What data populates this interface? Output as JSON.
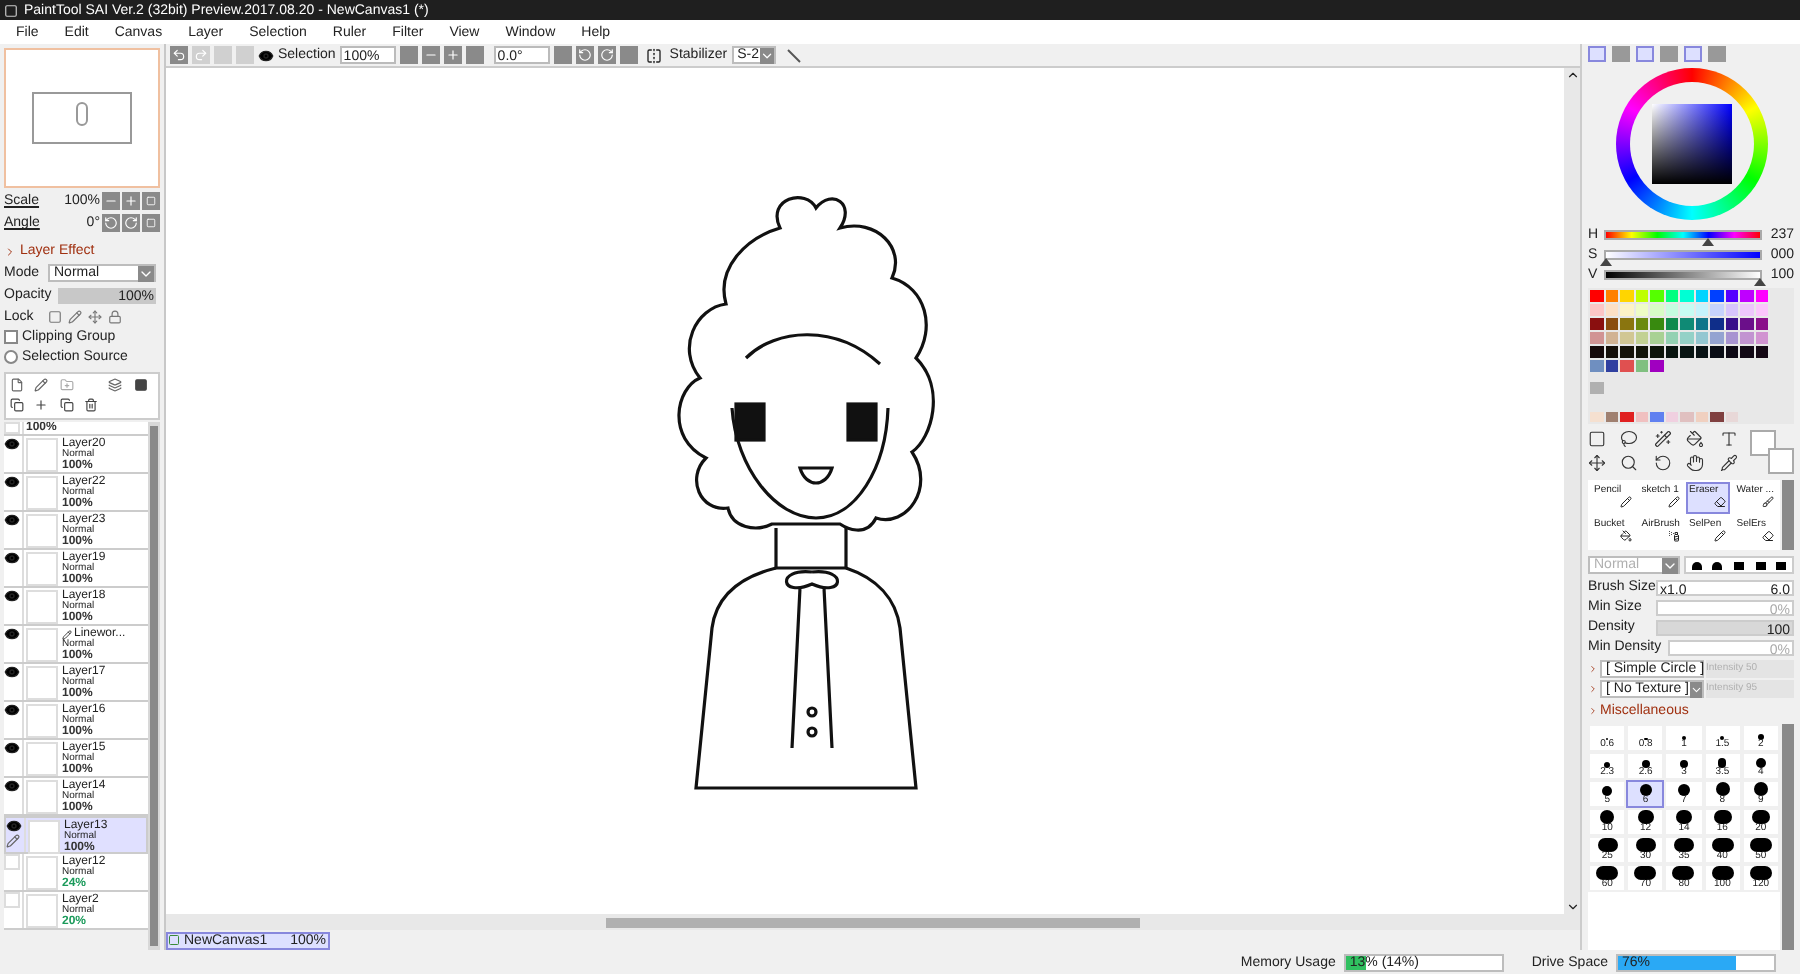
{
  "window": {
    "title": "PaintTool SAI Ver.2 (32bit) Preview.2017.08.20 - NewCanvas1 (*)"
  },
  "menu": [
    "File",
    "Edit",
    "Canvas",
    "Layer",
    "Selection",
    "Ruler",
    "Filter",
    "View",
    "Window",
    "Help"
  ],
  "toolbar": {
    "selection_label": "Selection",
    "selection_visible": true,
    "zoom": "100%",
    "angle": "0.0°",
    "stabilizer_label": "Stabilizer",
    "stabilizer": "S-2"
  },
  "navigator": {
    "scale_label": "Scale",
    "scale": "100%",
    "angle_label": "Angle",
    "angle": "0°"
  },
  "layer_effect": {
    "title": "Layer Effect",
    "mode_label": "Mode",
    "mode": "Normal",
    "opacity_label": "Opacity",
    "opacity": "100%",
    "level": 1,
    "lock_label": "Lock",
    "clipping_group": {
      "label": "Clipping Group",
      "checked": false
    },
    "selection_source": {
      "label": "Selection Source",
      "selected": false
    }
  },
  "layers": [
    {
      "kind": "partial",
      "opacity": "100%",
      "visible": false,
      "selected": false,
      "color": "#333333"
    },
    {
      "kind": "normal",
      "name": "Layer20",
      "mode": "Normal",
      "opacity": "100%",
      "visible": true,
      "selected": false,
      "color": "#333333"
    },
    {
      "kind": "normal",
      "name": "Layer22",
      "mode": "Normal",
      "opacity": "100%",
      "visible": true,
      "selected": false,
      "color": "#333333"
    },
    {
      "kind": "normal",
      "name": "Layer23",
      "mode": "Normal",
      "opacity": "100%",
      "visible": true,
      "selected": false,
      "color": "#333333"
    },
    {
      "kind": "normal",
      "name": "Layer19",
      "mode": "Normal",
      "opacity": "100%",
      "visible": true,
      "selected": false,
      "color": "#333333"
    },
    {
      "kind": "normal",
      "name": "Layer18",
      "mode": "Normal",
      "opacity": "100%",
      "visible": true,
      "selected": false,
      "color": "#333333"
    },
    {
      "kind": "linework",
      "name": "Linewor...",
      "mode": "Normal",
      "opacity": "100%",
      "visible": true,
      "selected": false,
      "color": "#333333"
    },
    {
      "kind": "normal",
      "name": "Layer17",
      "mode": "Normal",
      "opacity": "100%",
      "visible": true,
      "selected": false,
      "color": "#333333"
    },
    {
      "kind": "normal",
      "name": "Layer16",
      "mode": "Normal",
      "opacity": "100%",
      "visible": true,
      "selected": false,
      "color": "#333333"
    },
    {
      "kind": "normal",
      "name": "Layer15",
      "mode": "Normal",
      "opacity": "100%",
      "visible": true,
      "selected": false,
      "color": "#333333"
    },
    {
      "kind": "normal",
      "name": "Layer14",
      "mode": "Normal",
      "opacity": "100%",
      "visible": true,
      "selected": false,
      "color": "#333333"
    },
    {
      "kind": "normal",
      "name": "Layer13",
      "mode": "Normal",
      "opacity": "100%",
      "visible": true,
      "selected": true,
      "color": "#333333"
    },
    {
      "kind": "normal",
      "name": "Layer12",
      "mode": "Normal",
      "opacity": "24%",
      "visible": false,
      "selected": false,
      "color": "#1a9a5a"
    },
    {
      "kind": "normal",
      "name": "Layer2",
      "mode": "Normal",
      "opacity": "20%",
      "visible": false,
      "selected": false,
      "color": "#1a9a5a"
    }
  ],
  "canvas_tabs": [
    {
      "name": "NewCanvas1",
      "zoom": "100%",
      "selected": true
    }
  ],
  "color": {
    "h": {
      "label": "H",
      "value": "237",
      "level": 0.66
    },
    "s": {
      "label": "S",
      "value": "000",
      "level": 0
    },
    "v": {
      "label": "V",
      "value": "100",
      "level": 1
    }
  },
  "brush_tools": [
    {
      "name": "Pencil",
      "selected": false
    },
    {
      "name": "sketch 1",
      "selected": false
    },
    {
      "name": "Eraser",
      "selected": true
    },
    {
      "name": "Water ...",
      "selected": false
    },
    {
      "name": "Bucket",
      "selected": false
    },
    {
      "name": "AirBrush",
      "selected": false
    },
    {
      "name": "SelPen",
      "selected": false
    },
    {
      "name": "SelErs",
      "selected": false
    }
  ],
  "brush": {
    "blend": "Normal",
    "size_label": "Brush Size",
    "size_mult": "x1.0",
    "size": "6.0",
    "min_size_label": "Min Size",
    "min_size": "0%",
    "density_label": "Density",
    "density": "100",
    "min_density_label": "Min Density",
    "min_density": "0%",
    "shape": "[ Simple Circle ]",
    "shape_intensity": "Intensity 50",
    "texture": "[ No Texture ]",
    "texture_intensity": "Intensity 95",
    "misc": "Miscellaneous"
  },
  "brush_sizes": [
    {
      "label": "0.6",
      "selected": false
    },
    {
      "label": "0.8",
      "selected": false
    },
    {
      "label": "1",
      "selected": false
    },
    {
      "label": "1.5",
      "selected": false
    },
    {
      "label": "2",
      "selected": false
    },
    {
      "label": "2.3",
      "selected": false
    },
    {
      "label": "2.6",
      "selected": false
    },
    {
      "label": "3",
      "selected": false
    },
    {
      "label": "3.5",
      "selected": false
    },
    {
      "label": "4",
      "selected": false
    },
    {
      "label": "5",
      "selected": false
    },
    {
      "label": "6",
      "selected": true
    },
    {
      "label": "7",
      "selected": false
    },
    {
      "label": "8",
      "selected": false
    },
    {
      "label": "9",
      "selected": false
    },
    {
      "label": "10",
      "selected": false
    },
    {
      "label": "12",
      "selected": false
    },
    {
      "label": "14",
      "selected": false
    },
    {
      "label": "16",
      "selected": false
    },
    {
      "label": "20",
      "selected": false
    },
    {
      "label": "25",
      "selected": false
    },
    {
      "label": "30",
      "selected": false
    },
    {
      "label": "35",
      "selected": false
    },
    {
      "label": "40",
      "selected": false
    },
    {
      "label": "50",
      "selected": false
    },
    {
      "label": "60",
      "selected": false
    },
    {
      "label": "70",
      "selected": false
    },
    {
      "label": "80",
      "selected": false
    },
    {
      "label": "100",
      "selected": false
    },
    {
      "label": "120",
      "selected": false
    }
  ],
  "status": {
    "memory": {
      "label": "Memory Usage",
      "value": "13% (14%)",
      "level": 0.13
    },
    "drive": {
      "label": "Drive Space",
      "value": "76%",
      "level": 0.76
    }
  }
}
